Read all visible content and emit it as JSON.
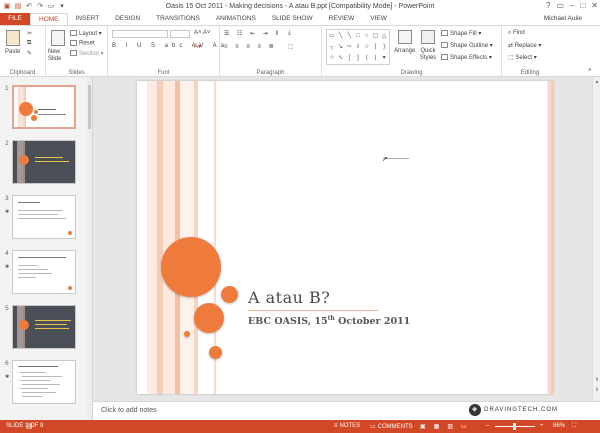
{
  "window": {
    "title": "Oasis 15 Oct 2011 - Making decisions - A atau B.ppt [Compatibility Mode] - PowerPoint",
    "user": "Michael Aulie",
    "controls": [
      "?",
      "▭",
      "–",
      "□",
      "✕"
    ]
  },
  "tabs": [
    "FILE",
    "HOME",
    "INSERT",
    "DESIGN",
    "TRANSITIONS",
    "ANIMATIONS",
    "SLIDE SHOW",
    "REVIEW",
    "VIEW"
  ],
  "ribbon": {
    "clipboard": {
      "label": "Clipboard",
      "paste": "Paste"
    },
    "slides": {
      "label": "Slides",
      "new_slide": "New Slide",
      "layout": "Layout",
      "reset": "Reset",
      "section": "Section"
    },
    "font": {
      "label": "Font"
    },
    "paragraph": {
      "label": "Paragraph"
    },
    "drawing": {
      "label": "Drawing",
      "arrange": "Arrange",
      "quick_styles": "Quick Styles",
      "shape_fill": "Shape Fill",
      "shape_outline": "Shape Outline",
      "shape_effects": "Shape Effects"
    },
    "editing": {
      "label": "Editing",
      "find": "Find",
      "replace": "Replace",
      "select": "Select"
    }
  },
  "thumbnails": [
    {
      "num": "1",
      "star": false,
      "kind": "title",
      "selected": true
    },
    {
      "num": "2",
      "star": false,
      "kind": "dark"
    },
    {
      "num": "3",
      "star": true,
      "kind": "text"
    },
    {
      "num": "4",
      "star": true,
      "kind": "text"
    },
    {
      "num": "5",
      "star": false,
      "kind": "dark"
    },
    {
      "num": "6",
      "star": true,
      "kind": "text"
    }
  ],
  "slide": {
    "title": "A atau B?",
    "subtitle": "EBC OASIS, 15",
    "subtitle_sup": "th",
    "subtitle_rest": " October 2011"
  },
  "notes": {
    "placeholder": "Click to add notes"
  },
  "watermark": "DRAVINGTECH.COM",
  "status": {
    "slide": "SLIDE 1 OF 9",
    "notes": "NOTES",
    "comments": "COMMENTS",
    "zoom": "86%"
  },
  "colors": {
    "accent": "#d24726",
    "circle": "#ee7b3c",
    "slide_text": "#4a4a4a"
  }
}
